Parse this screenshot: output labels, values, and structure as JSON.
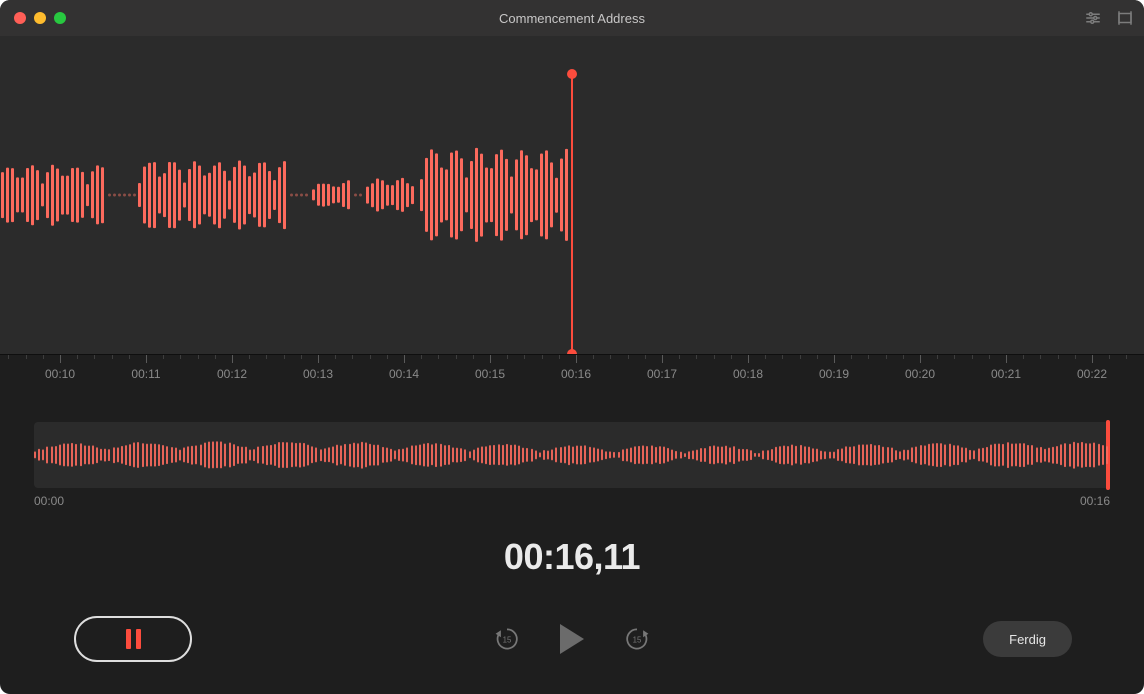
{
  "window": {
    "title": "Commencement Address"
  },
  "colors": {
    "accent": "#fc4c3d",
    "wave": "#fc6a5d",
    "bg": "#1e1e1e"
  },
  "ruler": {
    "labels": [
      "00:10",
      "00:11",
      "00:12",
      "00:13",
      "00:14",
      "00:15",
      "00:16",
      "00:17",
      "00:18",
      "00:19",
      "00:20",
      "00:21",
      "00:22"
    ]
  },
  "overview": {
    "start": "00:00",
    "end": "00:16"
  },
  "time": {
    "display": "00:16,11"
  },
  "controls": {
    "skip_back_seconds": "15",
    "skip_fwd_seconds": "15",
    "done_label": "Ferdig"
  },
  "icons": {
    "settings": "settings-icon",
    "trim": "trim-icon"
  }
}
